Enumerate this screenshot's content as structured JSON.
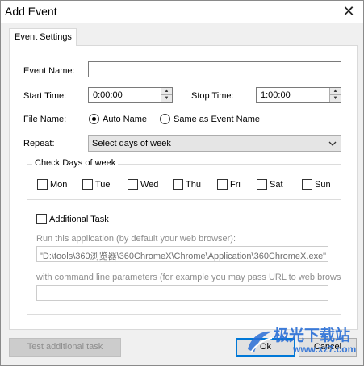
{
  "window": {
    "title": "Add Event",
    "close_glyph": "✕"
  },
  "tabs": [
    {
      "label": "Event Settings"
    }
  ],
  "form": {
    "event_name_label": "Event Name:",
    "event_name_value": "",
    "start_time_label": "Start Time:",
    "start_time_value": "0:00:00",
    "stop_time_label": "Stop Time:",
    "stop_time_value": "1:00:00",
    "file_name_label": "File Name:",
    "file_name_options": [
      {
        "label": "Auto Name",
        "checked": true
      },
      {
        "label": "Same as Event Name",
        "checked": false
      }
    ],
    "repeat_label": "Repeat:",
    "repeat_value": "Select days of week"
  },
  "days_group": {
    "title": "Check Days of week",
    "days": [
      {
        "label": "Mon",
        "checked": false
      },
      {
        "label": "Tue",
        "checked": false
      },
      {
        "label": "Wed",
        "checked": false
      },
      {
        "label": "Thu",
        "checked": false
      },
      {
        "label": "Fri",
        "checked": false
      },
      {
        "label": "Sat",
        "checked": false
      },
      {
        "label": "Sun",
        "checked": false
      }
    ]
  },
  "additional_task": {
    "label": "Additional Task",
    "checked": false,
    "run_app_label": "Run this application (by default your web browser):",
    "run_app_value": "\"D:\\tools\\360浏览器\\360ChromeX\\Chrome\\Application\\360ChromeX.exe\"",
    "params_label": "with command line parameters (for example you may pass URL to web browser",
    "params_value": ""
  },
  "buttons": {
    "test": "Test additional task",
    "ok": "Ok",
    "cancel": "Cancel"
  },
  "watermark": {
    "brand": "极光下载站",
    "url": "www.xz7.com"
  },
  "colors": {
    "accent": "#0078d7",
    "disabled_text": "#8d8d8d",
    "watermark": "#2a6fd6"
  }
}
